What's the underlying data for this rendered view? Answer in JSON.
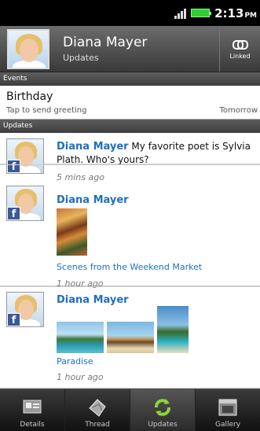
{
  "status": {
    "time": "2:13",
    "ampm": "PM"
  },
  "contact": {
    "name": "Diana Mayer",
    "subtitle": "Updates",
    "linked_label": "Linked"
  },
  "sections": {
    "events": "Events",
    "updates": "Updates"
  },
  "event": {
    "title": "Birthday",
    "subtitle": "Tap to send greeting",
    "when": "Tomorrow"
  },
  "posts": [
    {
      "author": "Diana Mayer",
      "text": "My favorite poet is Sylvia Plath. Who's yours?",
      "time": "5 mins ago"
    },
    {
      "author": "Diana Mayer",
      "caption": "Scenes from the Weekend Market",
      "time": "1 hour ago"
    },
    {
      "author": "Diana Mayer",
      "caption": "Paradise",
      "time": "1 hour ago"
    }
  ],
  "tabs": [
    {
      "label": "Details",
      "icon": "details-icon"
    },
    {
      "label": "Thread",
      "icon": "thread-icon"
    },
    {
      "label": "Updates",
      "icon": "updates-icon",
      "active": true
    },
    {
      "label": "Gallery",
      "icon": "gallery-icon"
    }
  ],
  "colors": {
    "link": "#1f6fbf",
    "facebook": "#3b5998",
    "update_green": "#8cd23c"
  }
}
